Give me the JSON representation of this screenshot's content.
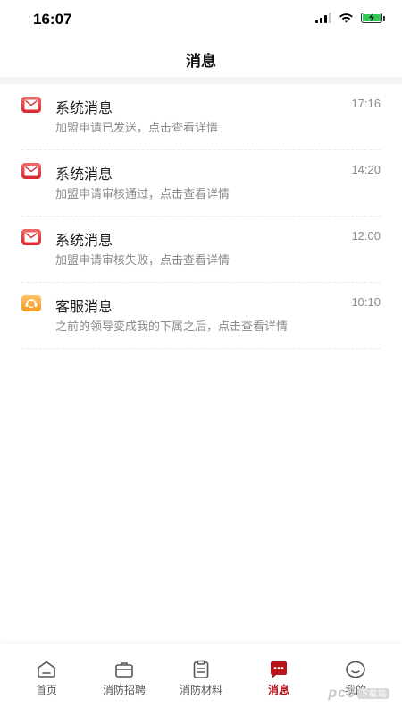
{
  "status_bar": {
    "time": "16:07"
  },
  "nav": {
    "title": "消息"
  },
  "messages": [
    {
      "type": "system",
      "title": "系统消息",
      "preview": "加盟申请已发送，点击查看详情",
      "time": "17:16"
    },
    {
      "type": "system",
      "title": "系统消息",
      "preview": "加盟申请审核通过，点击查看详情",
      "time": "14:20"
    },
    {
      "type": "system",
      "title": "系统消息",
      "preview": "加盟申请审核失败，点击查看详情",
      "time": "12:00"
    },
    {
      "type": "service",
      "title": "客服消息",
      "preview": "之前的领导变成我的下属之后，点击查看详情",
      "time": "10:10"
    }
  ],
  "tabs": [
    {
      "label": "首页",
      "icon": "home-icon",
      "active": false
    },
    {
      "label": "消防招聘",
      "icon": "briefcase-icon",
      "active": false
    },
    {
      "label": "消防材料",
      "icon": "clipboard-icon",
      "active": false
    },
    {
      "label": "消息",
      "icon": "chat-bubble-icon",
      "active": true
    },
    {
      "label": "我的",
      "icon": "smiley-icon",
      "active": false
    }
  ],
  "colors": {
    "accent": "#b8151b",
    "system_icon": "#e0383e",
    "service_icon": "#f5a623",
    "battery": "#34c759"
  },
  "watermark": {
    "text": "pc6",
    "badge": "下载站"
  }
}
